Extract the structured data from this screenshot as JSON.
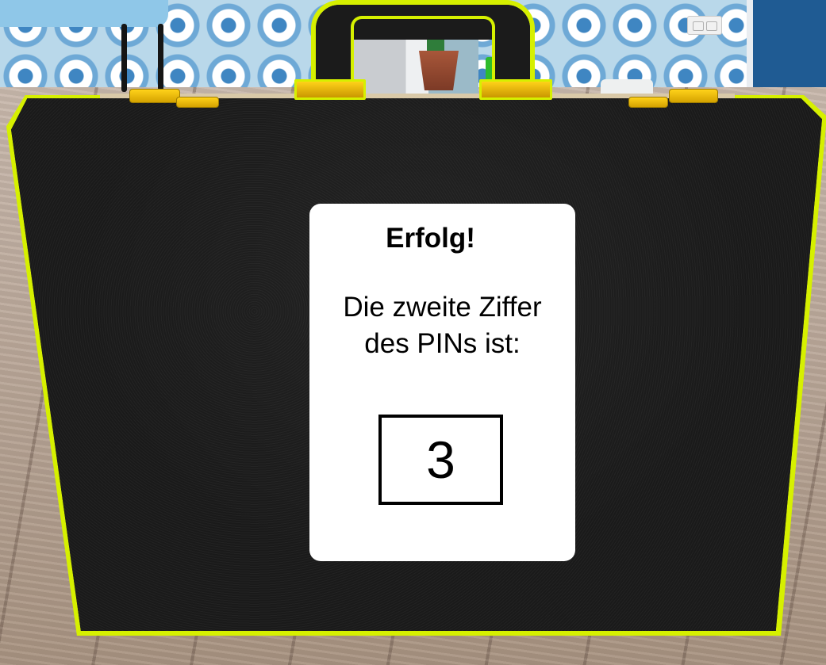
{
  "panel": {
    "title": "Erfolg!",
    "message": "Die zweite Ziffer\ndes PINs ist:",
    "digit": "3"
  },
  "colors": {
    "highlight_outline": "#d6f000",
    "briefcase": "#1c1c1c",
    "clasp": "#ffd21a",
    "panel_bg": "#ffffff",
    "text": "#000000"
  }
}
